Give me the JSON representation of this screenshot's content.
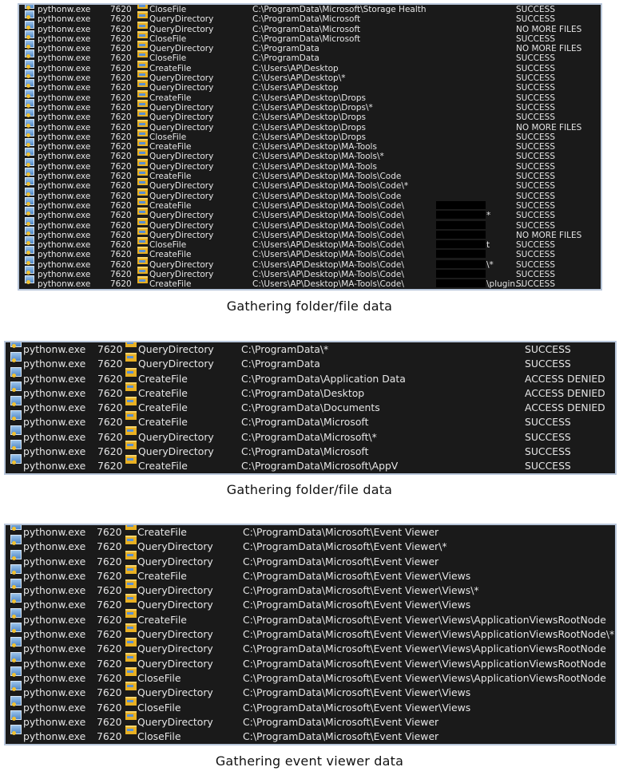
{
  "captions": {
    "first": "Gathering folder/file data",
    "second": "Gathering folder/file data",
    "third": "Gathering event viewer data"
  },
  "icons": {
    "process": "python-process-icon",
    "operation": "file-operation-icon"
  },
  "panels": [
    {
      "rows": [
        {
          "process": "pythonw.exe",
          "pid": "7620",
          "operation": "CloseFile",
          "path": "C:\\ProgramData\\Microsoft\\Storage Health",
          "result": "SUCCESS"
        },
        {
          "process": "pythonw.exe",
          "pid": "7620",
          "operation": "QueryDirectory",
          "path": "C:\\ProgramData\\Microsoft",
          "result": "SUCCESS"
        },
        {
          "process": "pythonw.exe",
          "pid": "7620",
          "operation": "QueryDirectory",
          "path": "C:\\ProgramData\\Microsoft",
          "result": "NO MORE FILES"
        },
        {
          "process": "pythonw.exe",
          "pid": "7620",
          "operation": "CloseFile",
          "path": "C:\\ProgramData\\Microsoft",
          "result": "SUCCESS"
        },
        {
          "process": "pythonw.exe",
          "pid": "7620",
          "operation": "QueryDirectory",
          "path": "C:\\ProgramData",
          "result": "NO MORE FILES"
        },
        {
          "process": "pythonw.exe",
          "pid": "7620",
          "operation": "CloseFile",
          "path": "C:\\ProgramData",
          "result": "SUCCESS"
        },
        {
          "process": "pythonw.exe",
          "pid": "7620",
          "operation": "CreateFile",
          "path": "C:\\Users\\AP\\Desktop",
          "result": "SUCCESS"
        },
        {
          "process": "pythonw.exe",
          "pid": "7620",
          "operation": "QueryDirectory",
          "path": "C:\\Users\\AP\\Desktop\\*",
          "result": "SUCCESS"
        },
        {
          "process": "pythonw.exe",
          "pid": "7620",
          "operation": "QueryDirectory",
          "path": "C:\\Users\\AP\\Desktop",
          "result": "SUCCESS"
        },
        {
          "process": "pythonw.exe",
          "pid": "7620",
          "operation": "CreateFile",
          "path": "C:\\Users\\AP\\Desktop\\Drops",
          "result": "SUCCESS"
        },
        {
          "process": "pythonw.exe",
          "pid": "7620",
          "operation": "QueryDirectory",
          "path": "C:\\Users\\AP\\Desktop\\Drops\\*",
          "result": "SUCCESS"
        },
        {
          "process": "pythonw.exe",
          "pid": "7620",
          "operation": "QueryDirectory",
          "path": "C:\\Users\\AP\\Desktop\\Drops",
          "result": "SUCCESS"
        },
        {
          "process": "pythonw.exe",
          "pid": "7620",
          "operation": "QueryDirectory",
          "path": "C:\\Users\\AP\\Desktop\\Drops",
          "result": "NO MORE FILES"
        },
        {
          "process": "pythonw.exe",
          "pid": "7620",
          "operation": "CloseFile",
          "path": "C:\\Users\\AP\\Desktop\\Drops",
          "result": "SUCCESS"
        },
        {
          "process": "pythonw.exe",
          "pid": "7620",
          "operation": "CreateFile",
          "path": "C:\\Users\\AP\\Desktop\\MA-Tools",
          "result": "SUCCESS"
        },
        {
          "process": "pythonw.exe",
          "pid": "7620",
          "operation": "QueryDirectory",
          "path": "C:\\Users\\AP\\Desktop\\MA-Tools\\*",
          "result": "SUCCESS"
        },
        {
          "process": "pythonw.exe",
          "pid": "7620",
          "operation": "QueryDirectory",
          "path": "C:\\Users\\AP\\Desktop\\MA-Tools",
          "result": "SUCCESS"
        },
        {
          "process": "pythonw.exe",
          "pid": "7620",
          "operation": "CreateFile",
          "path": "C:\\Users\\AP\\Desktop\\MA-Tools\\Code",
          "result": "SUCCESS"
        },
        {
          "process": "pythonw.exe",
          "pid": "7620",
          "operation": "QueryDirectory",
          "path": "C:\\Users\\AP\\Desktop\\MA-Tools\\Code\\*",
          "result": "SUCCESS"
        },
        {
          "process": "pythonw.exe",
          "pid": "7620",
          "operation": "QueryDirectory",
          "path": "C:\\Users\\AP\\Desktop\\MA-Tools\\Code",
          "result": "SUCCESS"
        },
        {
          "process": "pythonw.exe",
          "pid": "7620",
          "operation": "CreateFile",
          "path": "C:\\Users\\AP\\Desktop\\MA-Tools\\Code\\",
          "result": "SUCCESS",
          "redacted": true
        },
        {
          "process": "pythonw.exe",
          "pid": "7620",
          "operation": "QueryDirectory",
          "path": "C:\\Users\\AP\\Desktop\\MA-Tools\\Code\\",
          "suffix": "*",
          "result": "SUCCESS",
          "redacted": true
        },
        {
          "process": "pythonw.exe",
          "pid": "7620",
          "operation": "QueryDirectory",
          "path": "C:\\Users\\AP\\Desktop\\MA-Tools\\Code\\",
          "result": "SUCCESS",
          "redacted": true
        },
        {
          "process": "pythonw.exe",
          "pid": "7620",
          "operation": "QueryDirectory",
          "path": "C:\\Users\\AP\\Desktop\\MA-Tools\\Code\\",
          "result": "NO MORE FILES",
          "redacted": true
        },
        {
          "process": "pythonw.exe",
          "pid": "7620",
          "operation": "CloseFile",
          "path": "C:\\Users\\AP\\Desktop\\MA-Tools\\Code\\",
          "suffix": "t",
          "result": "SUCCESS",
          "redacted": true
        },
        {
          "process": "pythonw.exe",
          "pid": "7620",
          "operation": "CreateFile",
          "path": "C:\\Users\\AP\\Desktop\\MA-Tools\\Code\\",
          "result": "SUCCESS",
          "redacted": true
        },
        {
          "process": "pythonw.exe",
          "pid": "7620",
          "operation": "QueryDirectory",
          "path": "C:\\Users\\AP\\Desktop\\MA-Tools\\Code\\",
          "suffix": "\\*",
          "result": "SUCCESS",
          "redacted": true
        },
        {
          "process": "pythonw.exe",
          "pid": "7620",
          "operation": "QueryDirectory",
          "path": "C:\\Users\\AP\\Desktop\\MA-Tools\\Code\\",
          "result": "SUCCESS",
          "redacted": true
        },
        {
          "process": "pythonw.exe",
          "pid": "7620",
          "operation": "CreateFile",
          "path": "C:\\Users\\AP\\Desktop\\MA-Tools\\Code\\",
          "suffix": "\\plugin...",
          "result": "SUCCESS",
          "redacted": true
        }
      ]
    },
    {
      "rows": [
        {
          "process": "pythonw.exe",
          "pid": "7620",
          "operation": "QueryDirectory",
          "path": "C:\\ProgramData\\*",
          "result": "SUCCESS"
        },
        {
          "process": "pythonw.exe",
          "pid": "7620",
          "operation": "QueryDirectory",
          "path": "C:\\ProgramData",
          "result": "SUCCESS"
        },
        {
          "process": "pythonw.exe",
          "pid": "7620",
          "operation": "CreateFile",
          "path": "C:\\ProgramData\\Application Data",
          "result": "ACCESS DENIED"
        },
        {
          "process": "pythonw.exe",
          "pid": "7620",
          "operation": "CreateFile",
          "path": "C:\\ProgramData\\Desktop",
          "result": "ACCESS DENIED"
        },
        {
          "process": "pythonw.exe",
          "pid": "7620",
          "operation": "CreateFile",
          "path": "C:\\ProgramData\\Documents",
          "result": "ACCESS DENIED"
        },
        {
          "process": "pythonw.exe",
          "pid": "7620",
          "operation": "CreateFile",
          "path": "C:\\ProgramData\\Microsoft",
          "result": "SUCCESS"
        },
        {
          "process": "pythonw.exe",
          "pid": "7620",
          "operation": "QueryDirectory",
          "path": "C:\\ProgramData\\Microsoft\\*",
          "result": "SUCCESS"
        },
        {
          "process": "pythonw.exe",
          "pid": "7620",
          "operation": "QueryDirectory",
          "path": "C:\\ProgramData\\Microsoft",
          "result": "SUCCESS"
        },
        {
          "process": "pythonw.exe",
          "pid": "7620",
          "operation": "CreateFile",
          "path": "C:\\ProgramData\\Microsoft\\AppV",
          "result": "SUCCESS"
        }
      ]
    },
    {
      "rows": [
        {
          "process": "pythonw.exe",
          "pid": "7620",
          "operation": "CreateFile",
          "path": "C:\\ProgramData\\Microsoft\\Event Viewer"
        },
        {
          "process": "pythonw.exe",
          "pid": "7620",
          "operation": "QueryDirectory",
          "path": "C:\\ProgramData\\Microsoft\\Event Viewer\\*"
        },
        {
          "process": "pythonw.exe",
          "pid": "7620",
          "operation": "QueryDirectory",
          "path": "C:\\ProgramData\\Microsoft\\Event Viewer"
        },
        {
          "process": "pythonw.exe",
          "pid": "7620",
          "operation": "CreateFile",
          "path": "C:\\ProgramData\\Microsoft\\Event Viewer\\Views"
        },
        {
          "process": "pythonw.exe",
          "pid": "7620",
          "operation": "QueryDirectory",
          "path": "C:\\ProgramData\\Microsoft\\Event Viewer\\Views\\*"
        },
        {
          "process": "pythonw.exe",
          "pid": "7620",
          "operation": "QueryDirectory",
          "path": "C:\\ProgramData\\Microsoft\\Event Viewer\\Views"
        },
        {
          "process": "pythonw.exe",
          "pid": "7620",
          "operation": "CreateFile",
          "path": "C:\\ProgramData\\Microsoft\\Event Viewer\\Views\\ApplicationViewsRootNode"
        },
        {
          "process": "pythonw.exe",
          "pid": "7620",
          "operation": "QueryDirectory",
          "path": "C:\\ProgramData\\Microsoft\\Event Viewer\\Views\\ApplicationViewsRootNode\\*"
        },
        {
          "process": "pythonw.exe",
          "pid": "7620",
          "operation": "QueryDirectory",
          "path": "C:\\ProgramData\\Microsoft\\Event Viewer\\Views\\ApplicationViewsRootNode"
        },
        {
          "process": "pythonw.exe",
          "pid": "7620",
          "operation": "QueryDirectory",
          "path": "C:\\ProgramData\\Microsoft\\Event Viewer\\Views\\ApplicationViewsRootNode"
        },
        {
          "process": "pythonw.exe",
          "pid": "7620",
          "operation": "CloseFile",
          "path": "C:\\ProgramData\\Microsoft\\Event Viewer\\Views\\ApplicationViewsRootNode"
        },
        {
          "process": "pythonw.exe",
          "pid": "7620",
          "operation": "QueryDirectory",
          "path": "C:\\ProgramData\\Microsoft\\Event Viewer\\Views"
        },
        {
          "process": "pythonw.exe",
          "pid": "7620",
          "operation": "CloseFile",
          "path": "C:\\ProgramData\\Microsoft\\Event Viewer\\Views"
        },
        {
          "process": "pythonw.exe",
          "pid": "7620",
          "operation": "QueryDirectory",
          "path": "C:\\ProgramData\\Microsoft\\Event Viewer"
        },
        {
          "process": "pythonw.exe",
          "pid": "7620",
          "operation": "CloseFile",
          "path": "C:\\ProgramData\\Microsoft\\Event Viewer"
        }
      ]
    }
  ]
}
